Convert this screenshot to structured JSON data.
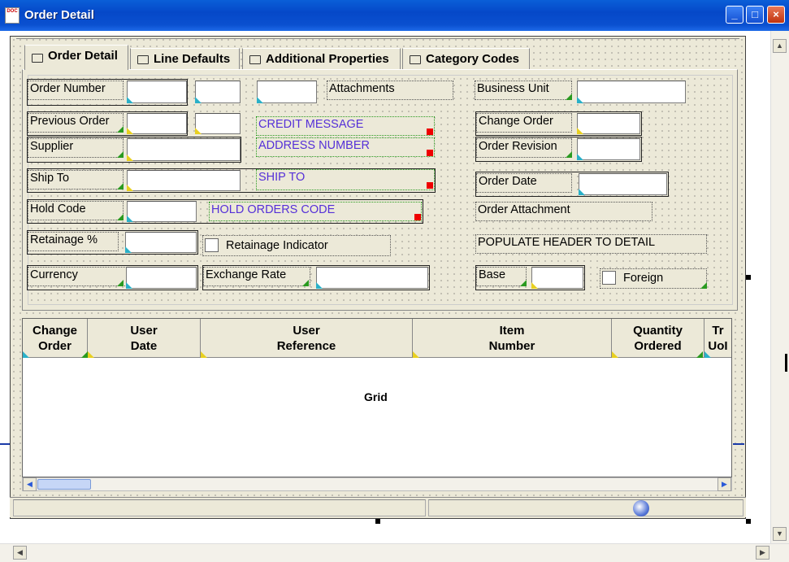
{
  "window": {
    "title": "Order Detail",
    "icon": "doc-app-icon",
    "buttons": [
      "_",
      "□",
      "×"
    ]
  },
  "tabs": [
    {
      "label": "Order Detail",
      "active": true
    },
    {
      "label": "Line Defaults",
      "active": false
    },
    {
      "label": "Additional Properties",
      "active": false
    },
    {
      "label": "Category Codes",
      "active": false
    }
  ],
  "form": {
    "order_number": "Order Number",
    "attachments": "Attachments",
    "business_unit": "Business Unit",
    "previous_order": "Previous Order",
    "credit_message": "CREDIT MESSAGE",
    "change_order": "Change Order",
    "supplier": "Supplier",
    "address_number": "ADDRESS NUMBER",
    "order_revision": "Order Revision",
    "ship_to": "Ship To",
    "ship_to_value": "SHIP TO",
    "order_date": "Order Date",
    "hold_code": "Hold Code",
    "hold_orders_code": "HOLD ORDERS CODE",
    "order_attachment": "Order Attachment",
    "retainage_pct": "Retainage %",
    "retainage_indicator": "Retainage Indicator",
    "populate_header": "POPULATE HEADER TO DETAIL",
    "currency": "Currency",
    "exchange_rate": "Exchange Rate",
    "base": "Base",
    "foreign": "Foreign"
  },
  "grid": {
    "columns": [
      {
        "line1": "Change",
        "line2": "Order"
      },
      {
        "line1": "User",
        "line2": "Date"
      },
      {
        "line1": "User",
        "line2": "Reference"
      },
      {
        "line1": "Item",
        "line2": "Number"
      },
      {
        "line1": "Quantity",
        "line2": "Ordered"
      },
      {
        "line1": "Tr",
        "line2": "UoI"
      }
    ],
    "label": "Grid"
  },
  "colors": {
    "titlebar": "#0548c8",
    "violet_text": "#5530d8",
    "marker_red": "#e00000"
  }
}
